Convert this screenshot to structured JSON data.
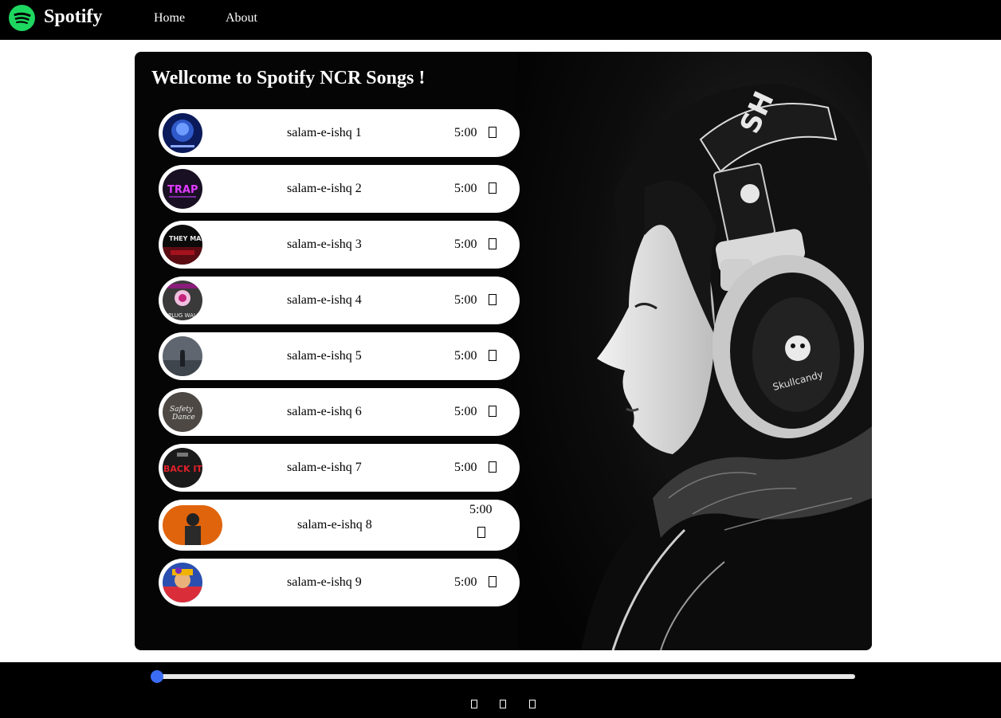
{
  "navbar": {
    "brand": "Spotify",
    "links": [
      "Home",
      "About"
    ],
    "logo_color": "#1ed760"
  },
  "main": {
    "heading": "Wellcome to Spotify NCR Songs !",
    "songs": [
      {
        "title": "salam-e-ishq 1",
        "duration": "5:00",
        "cover": "blue-face-cover",
        "play_icon": "play-icon"
      },
      {
        "title": "salam-e-ishq 2",
        "duration": "5:00",
        "cover": "trap-cover",
        "play_icon": "play-icon"
      },
      {
        "title": "salam-e-ishq 3",
        "duration": "5:00",
        "cover": "they-mad-cover",
        "play_icon": "play-icon"
      },
      {
        "title": "salam-e-ishq 4",
        "duration": "5:00",
        "cover": "pink-astronaut-cover",
        "play_icon": "play-icon"
      },
      {
        "title": "salam-e-ishq 5",
        "duration": "5:00",
        "cover": "foggy-figure-cover",
        "play_icon": "play-icon"
      },
      {
        "title": "salam-e-ishq 6",
        "duration": "5:00",
        "cover": "safety-dance-cover",
        "play_icon": "play-icon"
      },
      {
        "title": "salam-e-ishq 7",
        "duration": "5:00",
        "cover": "back-it-up-cover",
        "play_icon": "play-icon"
      },
      {
        "title": "salam-e-ishq 8",
        "duration": "5:00",
        "cover": "orange-portrait-cover",
        "play_icon": "play-icon"
      },
      {
        "title": "salam-e-ishq 9",
        "duration": "5:00",
        "cover": "colorful-portrait-cover",
        "play_icon": "play-icon"
      }
    ]
  },
  "player": {
    "progress": 0,
    "accent": "#3b6cf5",
    "controls": [
      "previous-icon",
      "play-icon",
      "next-icon"
    ]
  }
}
